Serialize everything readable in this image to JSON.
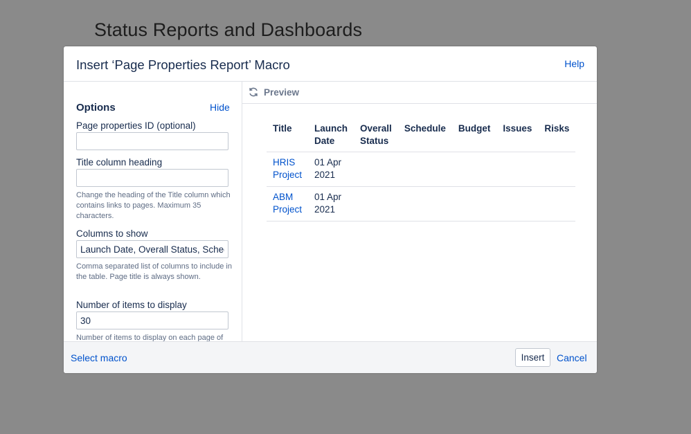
{
  "page": {
    "title": "Status Reports and Dashboards"
  },
  "dialog": {
    "title": "Insert ‘Page Properties Report’ Macro",
    "help_label": "Help",
    "options": {
      "heading": "Options",
      "hide_label": "Hide",
      "fields": [
        {
          "label": "Page properties ID (optional)",
          "value": ""
        },
        {
          "label": "Title column heading",
          "value": "",
          "description": "Change the heading of the Title column which contains links to pages. Maximum 35 characters."
        },
        {
          "label": "Columns to show",
          "value": "Launch Date, Overall Status, Schedule, Budget, Issues, Risks",
          "description": "Comma separated list of columns to include in the table. Page title is always shown."
        },
        {
          "label": "Number of items to display",
          "value": "30",
          "description": "Number of items to display on each page of"
        }
      ]
    },
    "preview": {
      "label": "Preview",
      "icon": "refresh-icon",
      "columns": [
        "Title",
        "Launch Date",
        "Overall Status",
        "Schedule",
        "Budget",
        "Issues",
        "Risks"
      ],
      "rows": [
        [
          "HRIS Project",
          "01 Apr 2021",
          "",
          "",
          "",
          "",
          ""
        ],
        [
          "ABM Project",
          "01 Apr 2021",
          "",
          "",
          "",
          "",
          ""
        ]
      ]
    },
    "footer": {
      "select_macro_label": "Select macro",
      "insert_label": "Insert",
      "cancel_label": "Cancel"
    }
  },
  "colors": {
    "link": "#0052cc",
    "text": "#172b4d",
    "overlay": "#8a8a8a"
  }
}
